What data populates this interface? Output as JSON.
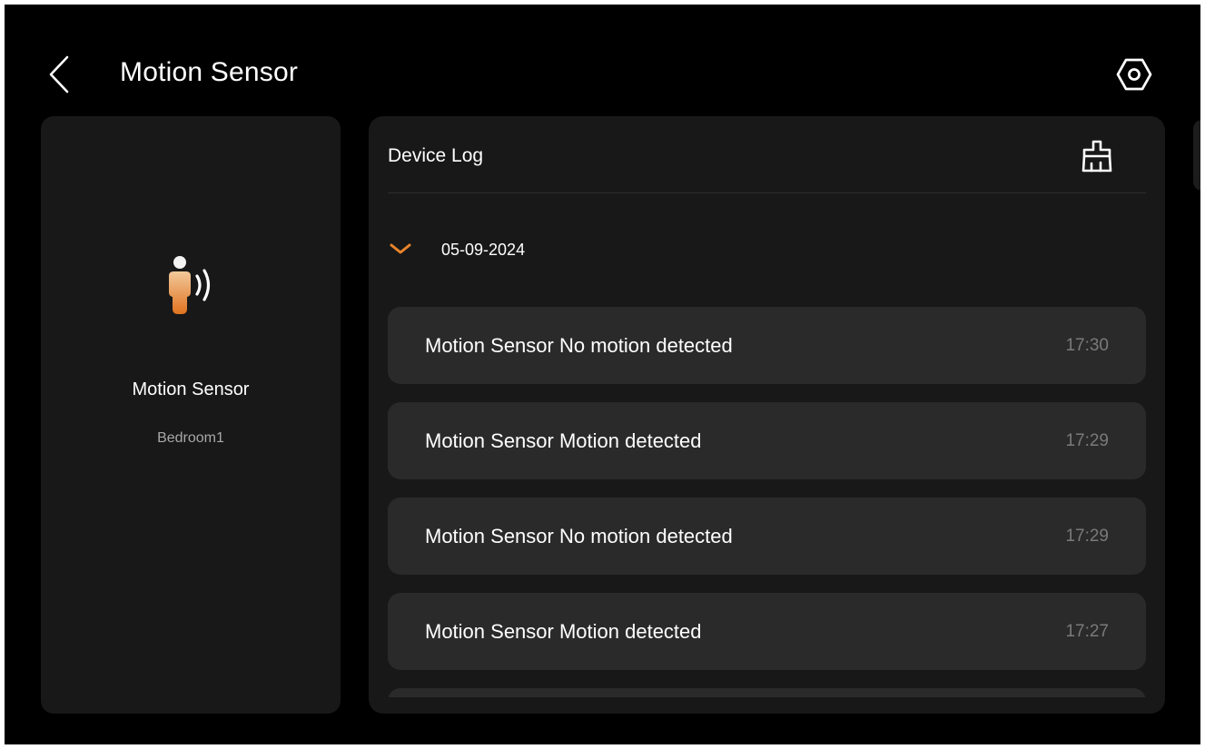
{
  "header": {
    "title": "Motion Sensor",
    "back_icon": "chevron-left-icon",
    "settings_icon": "settings-hexagon-icon"
  },
  "device": {
    "name": "Motion Sensor",
    "room": "Bedroom1",
    "icon": "motion-sensor-person-icon"
  },
  "log": {
    "title": "Device Log",
    "clear_icon": "brush-clean-icon",
    "date": "05-09-2024",
    "items": [
      {
        "message": "Motion Sensor No motion detected",
        "time": "17:30"
      },
      {
        "message": "Motion Sensor Motion detected",
        "time": "17:29"
      },
      {
        "message": "Motion Sensor No motion detected",
        "time": "17:29"
      },
      {
        "message": "Motion Sensor Motion detected",
        "time": "17:27"
      },
      {
        "message": "",
        "time": ""
      }
    ]
  },
  "colors": {
    "background": "#000000",
    "card": "#181818",
    "log_item": "#2a2a2a",
    "accent": "#E8842C",
    "text_primary": "#ffffff",
    "text_secondary": "#a8a8a8",
    "time_text": "#7a7a7a"
  }
}
